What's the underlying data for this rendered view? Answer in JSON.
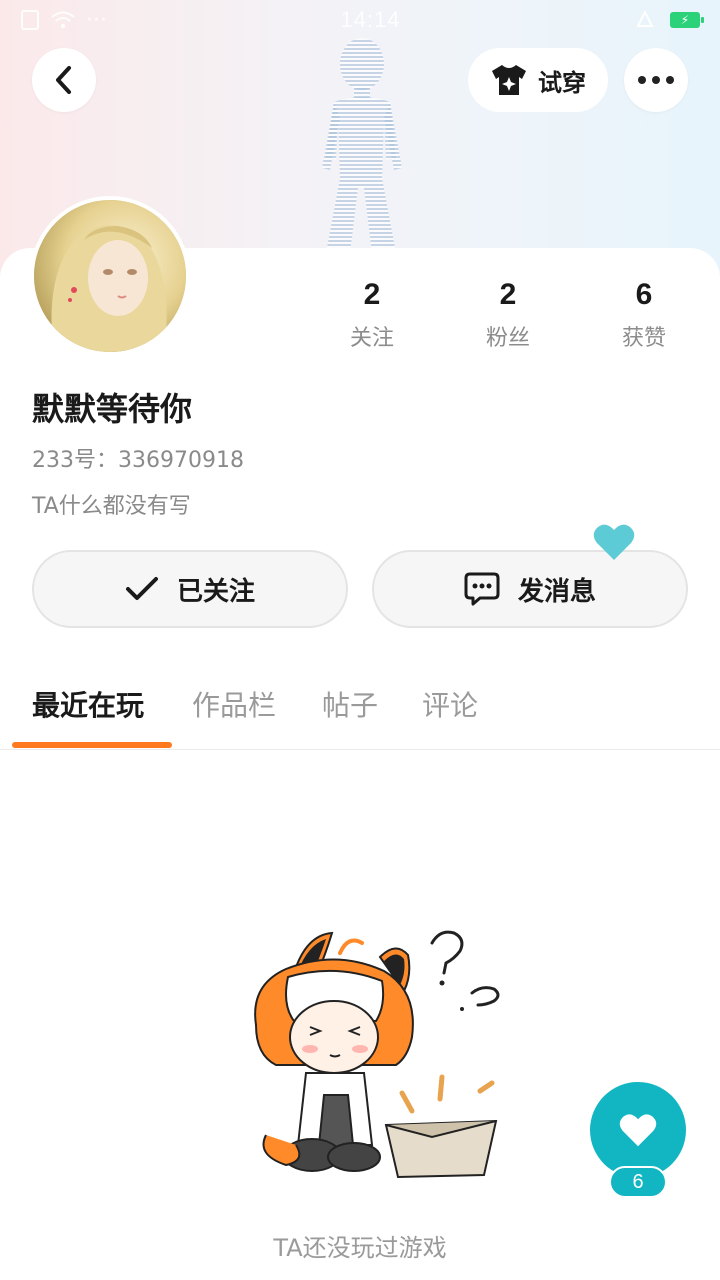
{
  "status_bar": {
    "time": "14:14",
    "signal_text": "···"
  },
  "header": {
    "back_icon": "chevron-left-icon",
    "tryon_label": "试穿",
    "tryon_icon": "tshirt-sparkle-icon",
    "more_icon": "more-dots-icon"
  },
  "profile": {
    "username": "默默等待你",
    "uid_text": "233号：336970918",
    "bio": "TA什么都没有写"
  },
  "stats": [
    {
      "value": "2",
      "label": "关注"
    },
    {
      "value": "2",
      "label": "粉丝"
    },
    {
      "value": "6",
      "label": "获赞"
    }
  ],
  "actions": {
    "follow_label": "已关注",
    "message_label": "发消息"
  },
  "tabs": [
    {
      "label": "最近在玩",
      "active": true
    },
    {
      "label": "作品栏",
      "active": false
    },
    {
      "label": "帖子",
      "active": false
    },
    {
      "label": "评论",
      "active": false
    }
  ],
  "empty_state": {
    "text": "TA还没玩过游戏"
  },
  "like_fab": {
    "count": "6"
  },
  "colors": {
    "accent": "#ff7a1f",
    "teal": "#12b6c3",
    "battery": "#2bd27a"
  }
}
